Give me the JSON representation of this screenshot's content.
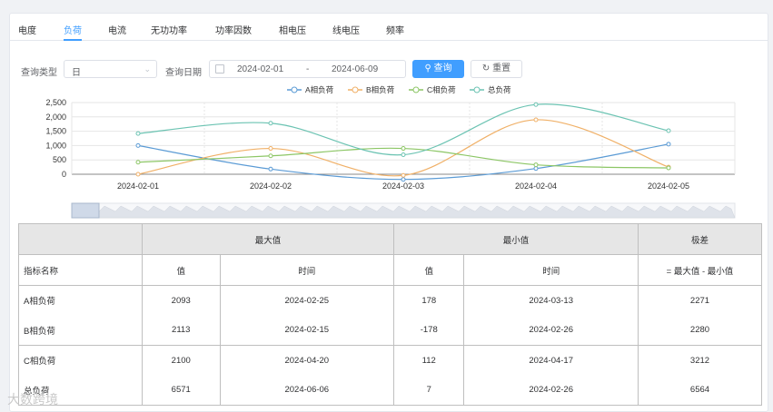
{
  "tabs": [
    "电度",
    "负荷",
    "电流",
    "无功功率",
    "功率因数",
    "相电压",
    "线电压",
    "频率"
  ],
  "active_tab": 1,
  "query": {
    "type_label": "查询类型",
    "type_value": "日",
    "date_label": "查询日期",
    "date_start": "2024-02-01",
    "date_sep": "-",
    "date_end": "2024-06-09",
    "query_button": "查询",
    "reset_button": "重置"
  },
  "chart_data": {
    "type": "line",
    "x": [
      "2024-02-01",
      "2024-02-02",
      "2024-02-03",
      "2024-02-04",
      "2024-02-05"
    ],
    "ylim": [
      0,
      2500
    ],
    "yticks": [
      "2,500",
      "2,000",
      "1,500",
      "1,000",
      "500",
      "0"
    ],
    "series": [
      {
        "name": "A相负荷",
        "color": "#5b9bd5",
        "values": [
          1000,
          180,
          -180,
          200,
          1050
        ]
      },
      {
        "name": "B相负荷",
        "color": "#f0b067",
        "values": [
          0,
          900,
          -40,
          1900,
          250
        ]
      },
      {
        "name": "C相负荷",
        "color": "#8cc665",
        "values": [
          420,
          640,
          900,
          330,
          220
        ]
      },
      {
        "name": "总负荷",
        "color": "#6bc3b2",
        "values": [
          1420,
          1780,
          680,
          2430,
          1520
        ]
      }
    ],
    "grid": true,
    "legend": "top"
  },
  "table": {
    "group_max": "最大值",
    "group_min": "最小值",
    "group_diff": "极差",
    "col_name": "指标名称",
    "col_value": "值",
    "col_time": "时间",
    "col_diff": "= 最大值 - 最小值",
    "rows": [
      {
        "name": "A相负荷",
        "max": "2093",
        "max_time": "2024-02-25",
        "min": "178",
        "min_time": "2024-03-13",
        "diff": "2271"
      },
      {
        "name": "B相负荷",
        "max": "2113",
        "max_time": "2024-02-15",
        "min": "-178",
        "min_time": "2024-02-26",
        "diff": "2280"
      },
      {
        "name": "C相负荷",
        "max": "2100",
        "max_time": "2024-04-20",
        "min": "112",
        "min_time": "2024-04-17",
        "diff": "3212"
      },
      {
        "name": "总负荷",
        "max": "6571",
        "max_time": "2024-06-06",
        "min": "7",
        "min_time": "2024-02-26",
        "diff": "6564"
      }
    ]
  },
  "watermark": "大数跨境"
}
